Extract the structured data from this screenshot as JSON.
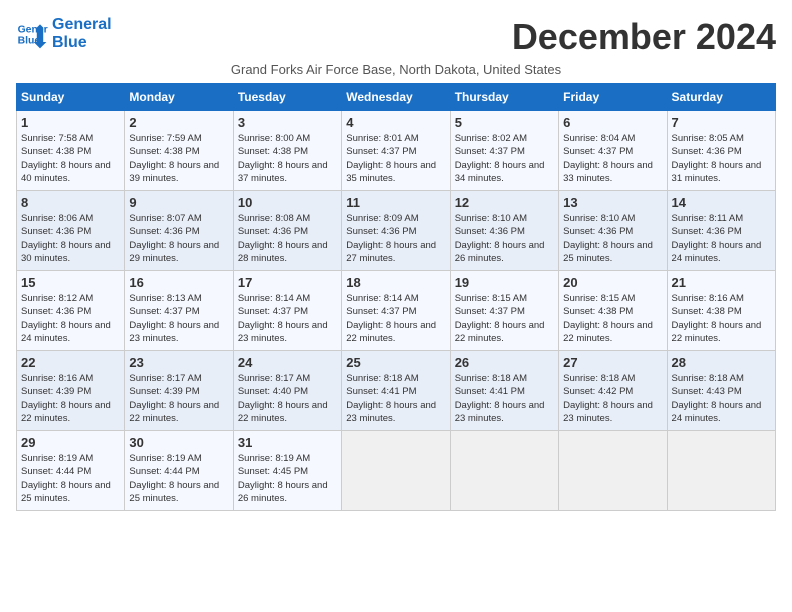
{
  "header": {
    "logo_line1": "General",
    "logo_line2": "Blue",
    "month_title": "December 2024",
    "subtitle": "Grand Forks Air Force Base, North Dakota, United States"
  },
  "days_of_week": [
    "Sunday",
    "Monday",
    "Tuesday",
    "Wednesday",
    "Thursday",
    "Friday",
    "Saturday"
  ],
  "weeks": [
    [
      {
        "day": "1",
        "sunrise": "7:58 AM",
        "sunset": "4:38 PM",
        "daylight": "8 hours and 40 minutes."
      },
      {
        "day": "2",
        "sunrise": "7:59 AM",
        "sunset": "4:38 PM",
        "daylight": "8 hours and 39 minutes."
      },
      {
        "day": "3",
        "sunrise": "8:00 AM",
        "sunset": "4:38 PM",
        "daylight": "8 hours and 37 minutes."
      },
      {
        "day": "4",
        "sunrise": "8:01 AM",
        "sunset": "4:37 PM",
        "daylight": "8 hours and 35 minutes."
      },
      {
        "day": "5",
        "sunrise": "8:02 AM",
        "sunset": "4:37 PM",
        "daylight": "8 hours and 34 minutes."
      },
      {
        "day": "6",
        "sunrise": "8:04 AM",
        "sunset": "4:37 PM",
        "daylight": "8 hours and 33 minutes."
      },
      {
        "day": "7",
        "sunrise": "8:05 AM",
        "sunset": "4:36 PM",
        "daylight": "8 hours and 31 minutes."
      }
    ],
    [
      {
        "day": "8",
        "sunrise": "8:06 AM",
        "sunset": "4:36 PM",
        "daylight": "8 hours and 30 minutes."
      },
      {
        "day": "9",
        "sunrise": "8:07 AM",
        "sunset": "4:36 PM",
        "daylight": "8 hours and 29 minutes."
      },
      {
        "day": "10",
        "sunrise": "8:08 AM",
        "sunset": "4:36 PM",
        "daylight": "8 hours and 28 minutes."
      },
      {
        "day": "11",
        "sunrise": "8:09 AM",
        "sunset": "4:36 PM",
        "daylight": "8 hours and 27 minutes."
      },
      {
        "day": "12",
        "sunrise": "8:10 AM",
        "sunset": "4:36 PM",
        "daylight": "8 hours and 26 minutes."
      },
      {
        "day": "13",
        "sunrise": "8:10 AM",
        "sunset": "4:36 PM",
        "daylight": "8 hours and 25 minutes."
      },
      {
        "day": "14",
        "sunrise": "8:11 AM",
        "sunset": "4:36 PM",
        "daylight": "8 hours and 24 minutes."
      }
    ],
    [
      {
        "day": "15",
        "sunrise": "8:12 AM",
        "sunset": "4:36 PM",
        "daylight": "8 hours and 24 minutes."
      },
      {
        "day": "16",
        "sunrise": "8:13 AM",
        "sunset": "4:37 PM",
        "daylight": "8 hours and 23 minutes."
      },
      {
        "day": "17",
        "sunrise": "8:14 AM",
        "sunset": "4:37 PM",
        "daylight": "8 hours and 23 minutes."
      },
      {
        "day": "18",
        "sunrise": "8:14 AM",
        "sunset": "4:37 PM",
        "daylight": "8 hours and 22 minutes."
      },
      {
        "day": "19",
        "sunrise": "8:15 AM",
        "sunset": "4:37 PM",
        "daylight": "8 hours and 22 minutes."
      },
      {
        "day": "20",
        "sunrise": "8:15 AM",
        "sunset": "4:38 PM",
        "daylight": "8 hours and 22 minutes."
      },
      {
        "day": "21",
        "sunrise": "8:16 AM",
        "sunset": "4:38 PM",
        "daylight": "8 hours and 22 minutes."
      }
    ],
    [
      {
        "day": "22",
        "sunrise": "8:16 AM",
        "sunset": "4:39 PM",
        "daylight": "8 hours and 22 minutes."
      },
      {
        "day": "23",
        "sunrise": "8:17 AM",
        "sunset": "4:39 PM",
        "daylight": "8 hours and 22 minutes."
      },
      {
        "day": "24",
        "sunrise": "8:17 AM",
        "sunset": "4:40 PM",
        "daylight": "8 hours and 22 minutes."
      },
      {
        "day": "25",
        "sunrise": "8:18 AM",
        "sunset": "4:41 PM",
        "daylight": "8 hours and 23 minutes."
      },
      {
        "day": "26",
        "sunrise": "8:18 AM",
        "sunset": "4:41 PM",
        "daylight": "8 hours and 23 minutes."
      },
      {
        "day": "27",
        "sunrise": "8:18 AM",
        "sunset": "4:42 PM",
        "daylight": "8 hours and 23 minutes."
      },
      {
        "day": "28",
        "sunrise": "8:18 AM",
        "sunset": "4:43 PM",
        "daylight": "8 hours and 24 minutes."
      }
    ],
    [
      {
        "day": "29",
        "sunrise": "8:19 AM",
        "sunset": "4:44 PM",
        "daylight": "8 hours and 25 minutes."
      },
      {
        "day": "30",
        "sunrise": "8:19 AM",
        "sunset": "4:44 PM",
        "daylight": "8 hours and 25 minutes."
      },
      {
        "day": "31",
        "sunrise": "8:19 AM",
        "sunset": "4:45 PM",
        "daylight": "8 hours and 26 minutes."
      },
      null,
      null,
      null,
      null
    ]
  ]
}
